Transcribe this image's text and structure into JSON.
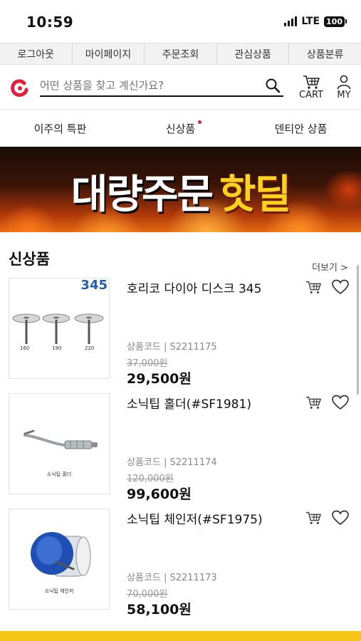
{
  "status": {
    "time": "10:59",
    "network": "LTE",
    "battery": "100"
  },
  "top_menu": {
    "items": [
      "로그아웃",
      "마이페이지",
      "주문조회",
      "관심상품",
      "상품분류"
    ]
  },
  "search": {
    "placeholder": "어떤 상품을 찾고 계신가요?"
  },
  "header": {
    "cart_label": "CART",
    "my_label": "MY"
  },
  "tabs": [
    "이주의 특판",
    "신상품",
    "덴티안 상품"
  ],
  "banner": {
    "text_white": "대량주문",
    "text_yellow": "핫딜"
  },
  "section": {
    "title": "신상품",
    "more": "더보기 >"
  },
  "products": [
    {
      "name": "호리코 다이아 디스크 345",
      "code": "상품코드 | S2211175",
      "old_price": "37,000원",
      "price": "29,500원",
      "thumb_number": "345",
      "thumb_labels": [
        "160",
        "190",
        "220"
      ]
    },
    {
      "name": "소닉팁 홀더(#SF1981)",
      "code": "상품코드 | S2211174",
      "old_price": "120,000원",
      "price": "99,600원",
      "thumb_caption": "소닉팁 홀더"
    },
    {
      "name": "소닉팁 체인저(#SF1975)",
      "code": "상품코드 | S2211173",
      "old_price": "70,000원",
      "price": "58,100원",
      "thumb_caption": "소닉팁 체인저"
    }
  ],
  "colors": {
    "accent_red": "#e0203a",
    "bottom_bar": "#f6c616",
    "thumb_blue": "#1f5fb0"
  }
}
